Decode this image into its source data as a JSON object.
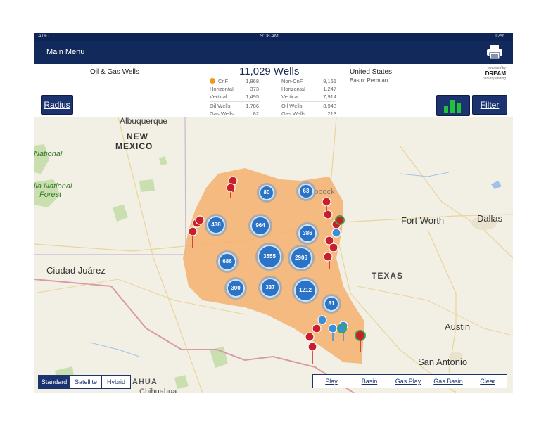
{
  "status": {
    "carrier": "AT&T",
    "time": "9:08 AM",
    "battery": "12%"
  },
  "nav": {
    "title": "Main Menu"
  },
  "header": {
    "category": "Oil & Gas Wells",
    "total": "11,029 Wells",
    "region": "United States",
    "basin": "Basin: Permian",
    "logo_top": "powered by",
    "logo": "DREAM",
    "logo_sub": "patent pending"
  },
  "stats": {
    "left": [
      {
        "label": "CnF",
        "value": "1,868"
      },
      {
        "label": "Horizontal",
        "value": "373"
      },
      {
        "label": "Vertical",
        "value": "1,495"
      },
      {
        "label": "Oil Wells",
        "value": "1,786"
      },
      {
        "label": "Gas Wells",
        "value": "82"
      }
    ],
    "right": [
      {
        "label": "Non-CnF",
        "value": "9,161"
      },
      {
        "label": "Horizontal",
        "value": "1,247"
      },
      {
        "label": "Vertical",
        "value": "7,914"
      },
      {
        "label": "Oil Wells",
        "value": "8,948"
      },
      {
        "label": "Gas Wells",
        "value": "213"
      }
    ]
  },
  "buttons": {
    "radius": "Radius",
    "filter": "Filter"
  },
  "map": {
    "labels": {
      "albuquerque": "Albuquerque",
      "new_mexico_1": "NEW",
      "new_mexico_2": "MEXICO",
      "national_1": "National",
      "national_2": "ila National",
      "forest": "Forest",
      "ciudad_juarez": "Ciudad Juárez",
      "lubbock": "Lubbock",
      "fort_worth": "Fort Worth",
      "dallas": "Dallas",
      "texas": "TEXAS",
      "austin": "Austin",
      "san_antonio": "San Antonio",
      "chihuahua_1": "AHUA",
      "chihuahua_2": "Chihuahua"
    },
    "clusters": [
      "80",
      "63",
      "438",
      "964",
      "386",
      "686",
      "3555",
      "2906",
      "300",
      "337",
      "1212",
      "81"
    ],
    "colors": {
      "basin_fill": "#f5b06f",
      "cluster": "#2a73c6",
      "oil_pin": "#c8202a",
      "gas_pin": "#3b8fd9",
      "cnf_ring": "#3aa84a"
    }
  },
  "map_types": [
    "Standard",
    "Satellite",
    "Hybrid"
  ],
  "map_type_selected": "Standard",
  "actions": [
    "Play",
    "Basin",
    "Gas Play",
    "Gas Basin",
    "Clear"
  ]
}
